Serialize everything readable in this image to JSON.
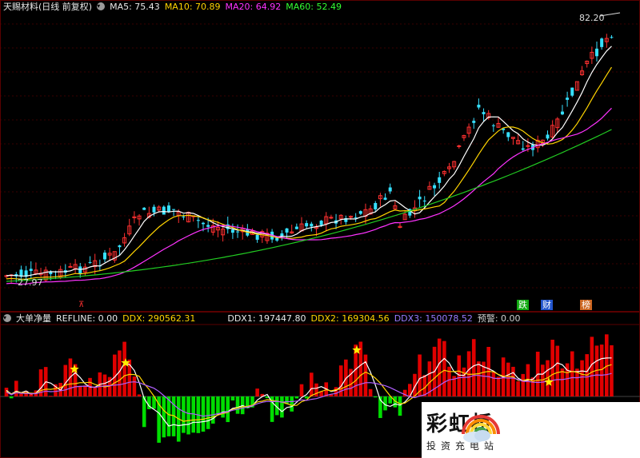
{
  "header": {
    "stock_name": "天赐材料(日线 前复权)",
    "ma5": "MA5: 75.43",
    "ma10": "MA10: 70.89",
    "ma20": "MA20: 64.92",
    "ma60": "MA60: 52.49"
  },
  "price_panel": {
    "high_label": "82.20",
    "low_label": "27.97",
    "tag_left": "⊼",
    "tag_green": "跌",
    "tag_blue": "财",
    "tag_orange": "榜"
  },
  "indicator": {
    "name": "大单净量",
    "refline": "REFLINE: 0.00",
    "ddx": "DDX: 290562.31",
    "ddx1": "DDX1: 197447.80",
    "ddx2": "DDX2: 169304.56",
    "ddx3": "DDX3: 150078.52",
    "alert": "预警: 0.00"
  },
  "watermark": {
    "title": "彩虹桥",
    "subtitle": "投资充电站"
  },
  "colors": {
    "up": "#ff3030",
    "down": "#36e0ff",
    "ma5": "#ffffff",
    "ma10": "#ffd400",
    "ma20": "#ff33ff",
    "ma60": "#22cc22",
    "bar_pos": "#e00000",
    "bar_neg": "#00dd00"
  }
}
